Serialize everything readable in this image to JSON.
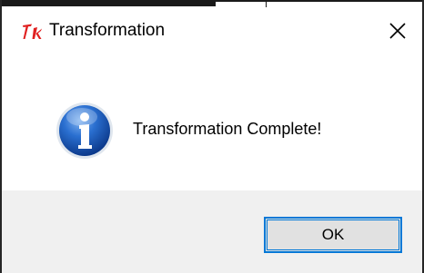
{
  "dialog": {
    "title": "Transformation",
    "app_icon": "tk-feather-icon",
    "close_icon": "close-icon",
    "message_icon": "info-icon",
    "message": "Transformation Complete!",
    "ok_label": "OK"
  },
  "colors": {
    "accent": "#0078d7",
    "footer_bg": "#f0f0f0",
    "tk_red": "#e02020",
    "info_blue": "#1f5fbf"
  }
}
